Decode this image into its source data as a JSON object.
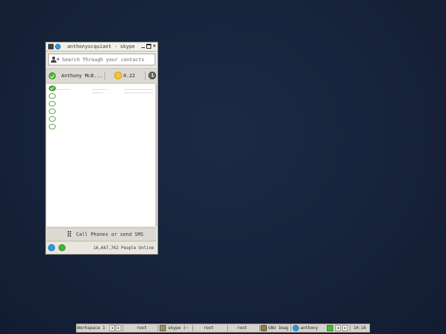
{
  "window": {
    "title": "anthonyocquiant - skype",
    "buttons": {
      "minimize": "_",
      "maximize": "□",
      "close": "×"
    }
  },
  "search": {
    "placeholder": "Search Through your contacts"
  },
  "status_bar": {
    "user_name": "Anthony Mc8...",
    "credit": "0.22"
  },
  "contacts": {
    "status_icons": [
      "online",
      "offline",
      "offline",
      "offline",
      "offline",
      "offline"
    ]
  },
  "call_bar": {
    "label": "Call Phones or send SMS"
  },
  "footer": {
    "online_count": "16,667,762 People Online"
  },
  "taskbar": {
    "workspace": "Workspace 1",
    "items": [
      "root",
      "skype (~",
      "root",
      "root",
      "GNU Imag",
      "anthony"
    ],
    "clock": "10:16"
  },
  "colors": {
    "desktop": "#17233b",
    "online_green": "#4fb43a",
    "skype_blue": "#2d9be0",
    "credit_gold": "#f7c531"
  }
}
